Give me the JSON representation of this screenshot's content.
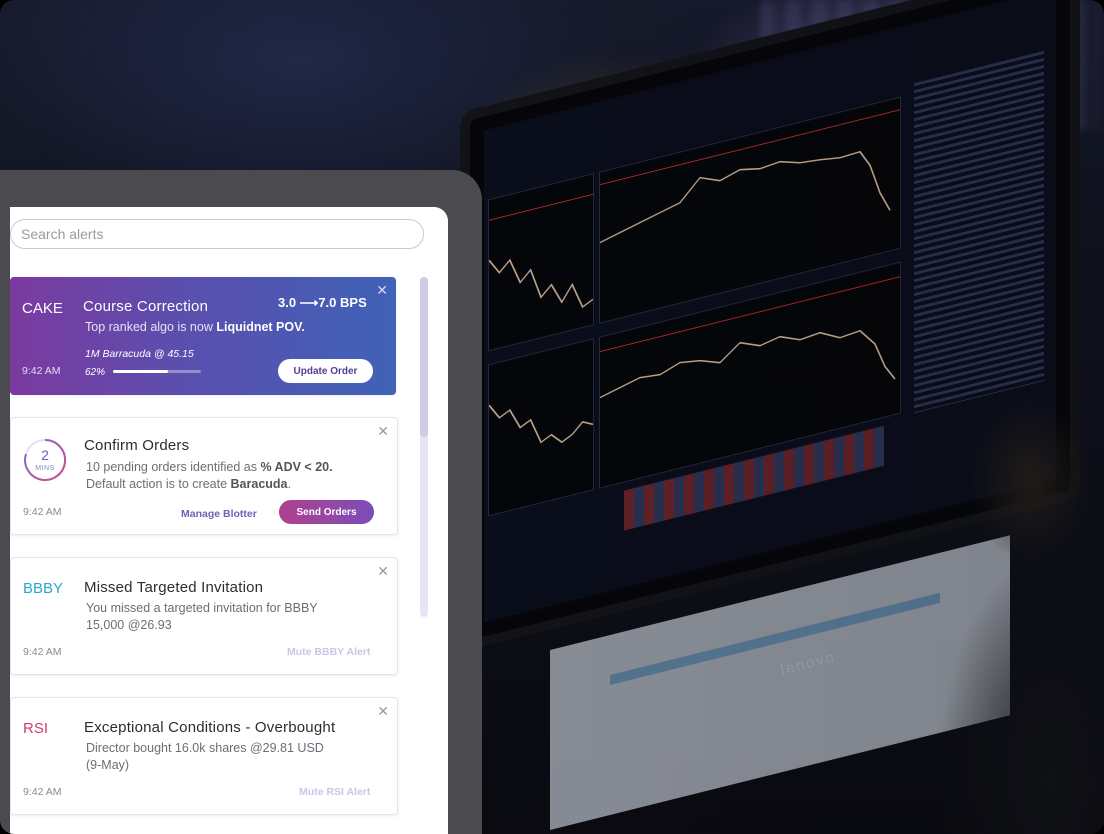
{
  "search": {
    "placeholder": "Search alerts"
  },
  "alerts": [
    {
      "ticker": "CAKE",
      "title": "Course Correction",
      "bps": "3.0 ⟶7.0 BPS",
      "body_prefix": "Top ranked algo is now ",
      "body_bold": "Liquidnet POV.",
      "order_line": "1M Barracuda @ 45.15",
      "progress_text": "62%",
      "progress_value": 0.62,
      "time": "9:42 AM",
      "action": "Update Order"
    },
    {
      "ring_number": "2",
      "ring_unit": "MINS",
      "title": "Confirm Orders",
      "line1_prefix": "10 pending orders identified as ",
      "line1_bold": "% ADV < 20.",
      "line2_prefix": "Default action is to create ",
      "line2_bold": "Baracuda",
      "line2_suffix": ".",
      "time": "9:42 AM",
      "secondary_action": "Manage Blotter",
      "action": "Send Orders"
    },
    {
      "ticker": "BBBY",
      "ticker_color": "#2aa8c9",
      "title": "Missed Targeted Invitation",
      "line1": "You missed a targeted invitation for BBBY",
      "line2": "15,000 @26.93",
      "time": "9:42 AM",
      "action": "Mute BBBY Alert"
    },
    {
      "ticker": "RSI",
      "ticker_color": "#d23a6b",
      "title": "Exceptional Conditions - Overbought",
      "line1": "Director bought 16.0k shares @29.81 USD",
      "line2": "(9-May)",
      "time": "9:42 AM",
      "action": "Mute RSI Alert"
    }
  ],
  "background": {
    "monitor_brand": "lenovo"
  },
  "colors": {
    "accent_purple": "#6c63b5",
    "featured_start": "#7b3aa0",
    "featured_end": "#3f62b7"
  }
}
